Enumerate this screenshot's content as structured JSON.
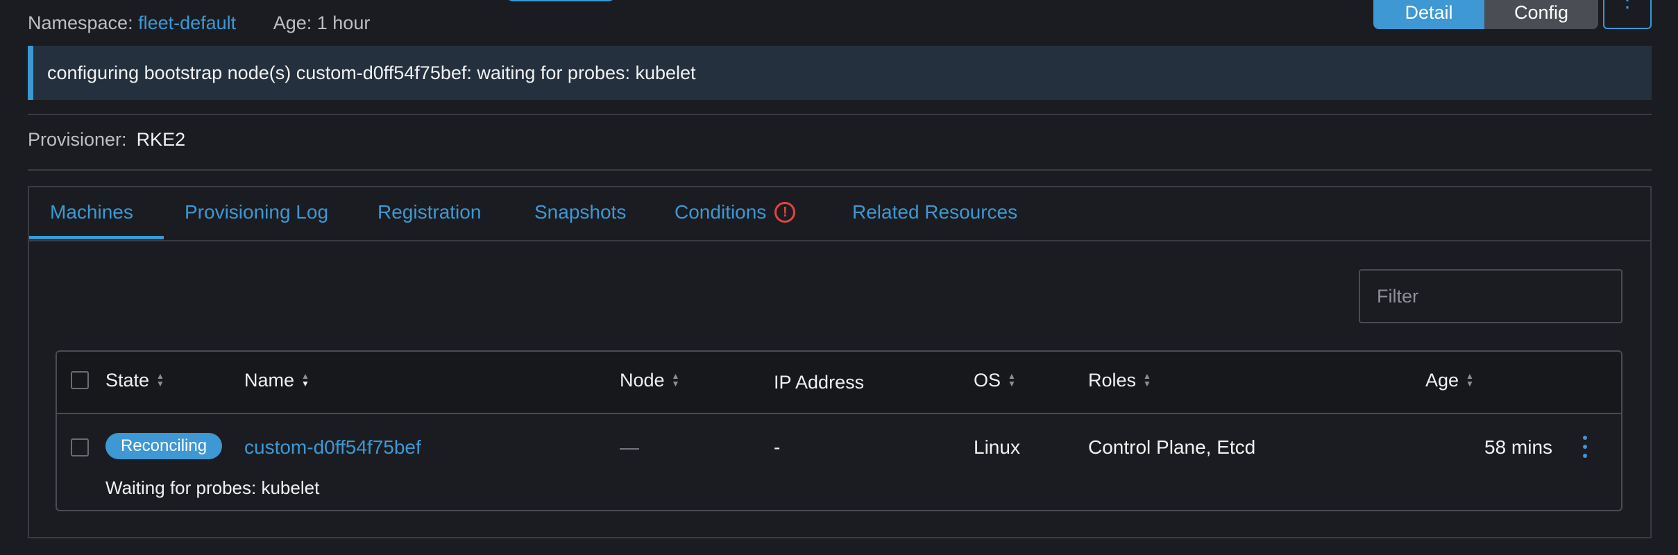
{
  "header": {
    "namespace_label": "Namespace:",
    "namespace_value": "fleet-default",
    "age_label": "Age: 1 hour",
    "buttons": {
      "detail": "Detail",
      "config": "Config",
      "more": "⋮"
    }
  },
  "banner": {
    "message": "configuring bootstrap node(s) custom-d0ff54f75bef: waiting for probes: kubelet"
  },
  "provisioner": {
    "label": "Provisioner:",
    "value": "RKE2"
  },
  "tabs": [
    {
      "label": "Machines",
      "active": true
    },
    {
      "label": "Provisioning Log"
    },
    {
      "label": "Registration"
    },
    {
      "label": "Snapshots"
    },
    {
      "label": "Conditions",
      "icon": "error-circle-icon"
    },
    {
      "label": "Related Resources"
    }
  ],
  "filter": {
    "placeholder": "Filter",
    "value": ""
  },
  "table": {
    "columns": [
      "State",
      "Name",
      "Node",
      "IP Address",
      "OS",
      "Roles",
      "Age"
    ],
    "rows": [
      {
        "state": "Reconciling",
        "name": "custom-d0ff54f75bef",
        "node": "—",
        "ip": "-",
        "os": "Linux",
        "roles": "Control Plane, Etcd",
        "age": "58 mins",
        "message": "Waiting for probes: kubelet"
      }
    ]
  },
  "colors": {
    "accent": "#3d98d3",
    "error": "#e0463e",
    "background": "#1b1c21"
  }
}
